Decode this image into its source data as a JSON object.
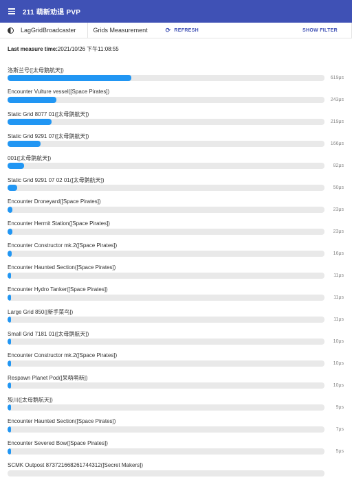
{
  "app": {
    "title": "211 萌新劝退 PVP"
  },
  "toolbar": {
    "broadcaster": "LagGridBroadcaster",
    "tab": "Grids Measurement",
    "refresh": "REFRESH",
    "show_filter": "SHOW FILTER"
  },
  "measure": {
    "label": "Last measure time:",
    "value": "2021/10/26 下午11:08:55"
  },
  "grids": [
    {
      "name": "洛斯兰号([太母鹅航天])",
      "value_text": "619μs",
      "fraction": 0.39
    },
    {
      "name": "Encounter Vulture vessel([Space Pirates])",
      "value_text": "243μs",
      "fraction": 0.154
    },
    {
      "name": "Static Grid 8077 01([太母鹅航天])",
      "value_text": "219μs",
      "fraction": 0.138
    },
    {
      "name": "Static Grid 9291 07([太母鹅航天])",
      "value_text": "166μs",
      "fraction": 0.105
    },
    {
      "name": "001([太母鹅航天])",
      "value_text": "82μs",
      "fraction": 0.052
    },
    {
      "name": "Static Grid 9291 07 02 01([太母鹅航天])",
      "value_text": "50μs",
      "fraction": 0.031
    },
    {
      "name": "Encounter Droneyard([Space Pirates])",
      "value_text": "23μs",
      "fraction": 0.015
    },
    {
      "name": "Encounter Hermit Station([Space Pirates])",
      "value_text": "23μs",
      "fraction": 0.015
    },
    {
      "name": "Encounter Constructor mk.2([Space Pirates])",
      "value_text": "16μs",
      "fraction": 0.012
    },
    {
      "name": "Encounter Haunted Section([Space Pirates])",
      "value_text": "11μs",
      "fraction": 0.008
    },
    {
      "name": "Encounter Hydro Tanker([Space Pirates])",
      "value_text": "11μs",
      "fraction": 0.008
    },
    {
      "name": "Large Grid 850([新手菜鸟])",
      "value_text": "11μs",
      "fraction": 0.008
    },
    {
      "name": "Small Grid 7181 01([太母鹅航天])",
      "value_text": "10μs",
      "fraction": 0.007
    },
    {
      "name": "Encounter Constructor mk.2([Space Pirates])",
      "value_text": "10μs",
      "fraction": 0.007
    },
    {
      "name": "Respawn Planet Pod([呆萌萌新])",
      "value_text": "10μs",
      "fraction": 0.007
    },
    {
      "name": "殁川([太母鹅航天])",
      "value_text": "9μs",
      "fraction": 0.006
    },
    {
      "name": "Encounter Haunted Section([Space Pirates])",
      "value_text": "7μs",
      "fraction": 0.005
    },
    {
      "name": "Encounter Severed Bow([Space Pirates])",
      "value_text": "5μs",
      "fraction": 0.004
    },
    {
      "name": "SCMK Outpost 873721668261744312([Secret Makers])",
      "value_text": "",
      "fraction": 0
    }
  ]
}
